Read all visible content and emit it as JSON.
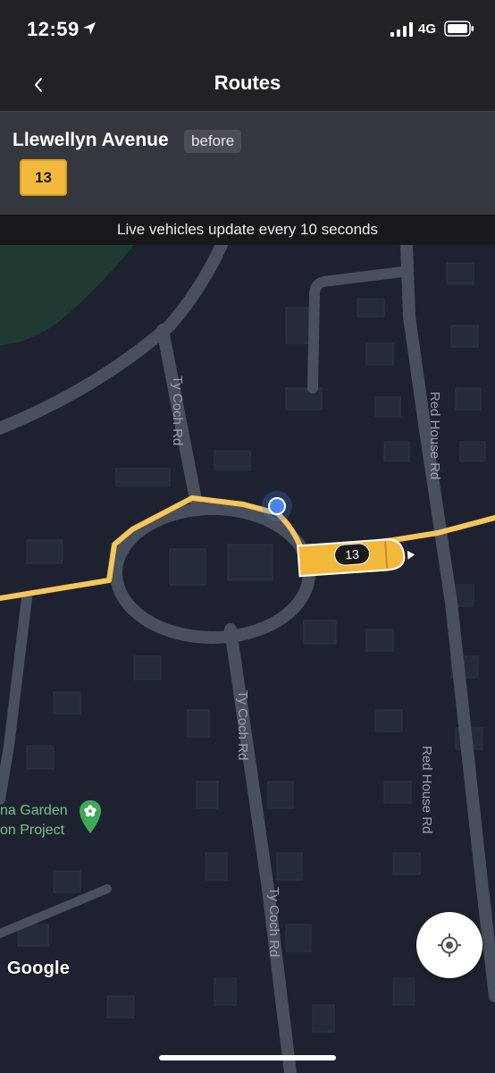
{
  "status_bar": {
    "time": "12:59",
    "network": "4G"
  },
  "nav": {
    "title": "Routes"
  },
  "stop": {
    "name": "Llewellyn Avenue",
    "tag": "before",
    "route": "13"
  },
  "banner": {
    "text": "Live vehicles update every 10 seconds"
  },
  "map": {
    "street_labels": [
      "Ty Coch Rd",
      "Red House Rd",
      "Ty Coch Rd",
      "Red House Rd",
      "Ty Coch Rd"
    ],
    "poi": {
      "line1": "na Garden",
      "line2": "on Project"
    },
    "vehicle": {
      "route": "13"
    },
    "attribution": "Google"
  },
  "colors": {
    "accent": "#f3b93b",
    "route_line": "#f6c65b",
    "map_bg": "#1e2230",
    "user_location": "#4a86e8"
  }
}
